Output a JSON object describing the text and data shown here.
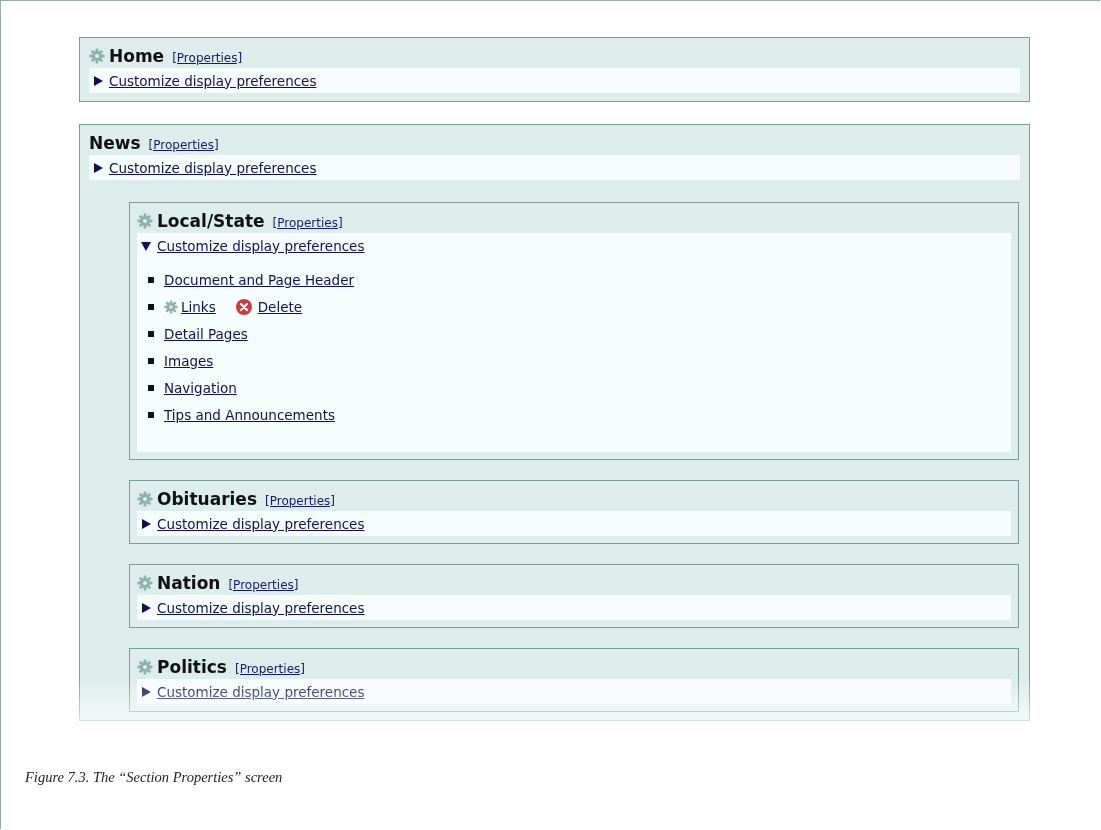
{
  "sections": [
    {
      "title": "Home",
      "gear": true,
      "properties": "[Properties]",
      "customize": "Customize display preferences",
      "expanded": false
    },
    {
      "title": "News",
      "gear": false,
      "properties": "[Properties]",
      "customize": "Customize display preferences",
      "expanded": false,
      "children": [
        {
          "title": "Local/State",
          "gear": true,
          "properties": "[Properties]",
          "customize": "Customize display preferences",
          "expanded": true,
          "items": [
            {
              "label": "Document and Page Header",
              "gear": false
            },
            {
              "label": "Links",
              "gear": true,
              "actions": [
                {
                  "kind": "delete",
                  "label": "Delete"
                }
              ]
            },
            {
              "label": "Detail Pages",
              "gear": false
            },
            {
              "label": "Images",
              "gear": false
            },
            {
              "label": "Navigation",
              "gear": false
            },
            {
              "label": "Tips and Announcements",
              "gear": false
            }
          ]
        },
        {
          "title": "Obituaries",
          "gear": true,
          "properties": "[Properties]",
          "customize": "Customize display preferences",
          "expanded": false
        },
        {
          "title": "Nation",
          "gear": true,
          "properties": "[Properties]",
          "customize": "Customize display preferences",
          "expanded": false
        },
        {
          "title": "Politics",
          "gear": true,
          "properties": "[Properties]",
          "customize": "Customize display preferences",
          "expanded": false
        }
      ]
    }
  ],
  "caption": "Figure 7.3. The “Section Properties” screen"
}
